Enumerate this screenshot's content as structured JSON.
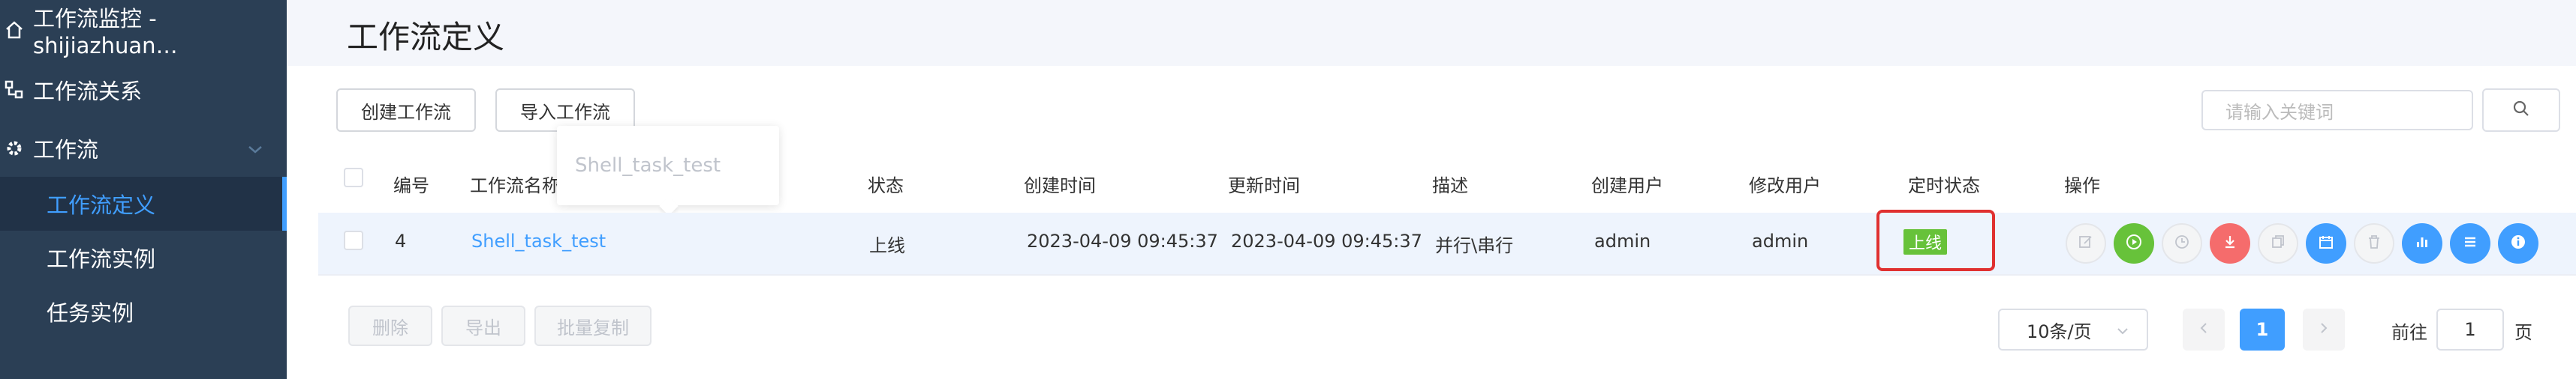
{
  "sidebar": {
    "items": [
      {
        "label": "工作流监控 - shijiazhuan…",
        "icon": "home-icon"
      },
      {
        "label": "工作流关系",
        "icon": "relation-icon"
      },
      {
        "label": "工作流",
        "icon": "gear-icon"
      }
    ],
    "sub_items": [
      {
        "label": "工作流定义",
        "active": true
      },
      {
        "label": "工作流实例",
        "active": false
      },
      {
        "label": "任务实例",
        "active": false
      }
    ]
  },
  "header": {
    "title": "工作流定义"
  },
  "toolbar": {
    "create_label": "创建工作流",
    "import_label": "导入工作流",
    "search_placeholder": "请输入关键词"
  },
  "tooltip": {
    "text": "Shell_task_test"
  },
  "table": {
    "headers": [
      "编号",
      "工作流名称",
      "状态",
      "创建时间",
      "更新时间",
      "描述",
      "创建用户",
      "修改用户",
      "定时状态",
      "操作"
    ],
    "rows": [
      {
        "id": "4",
        "name": "Shell_task_test",
        "status": "上线",
        "created": "2023-04-09 09:45:37",
        "updated": "2023-04-09 09:45:37",
        "description": "并行\\串行",
        "creator": "admin",
        "modifier": "admin",
        "schedule_status": "上线"
      }
    ]
  },
  "operations": [
    "edit-icon",
    "run-icon",
    "timer-icon",
    "download-icon",
    "copy-icon",
    "calendar-icon",
    "delete-icon",
    "chart-icon",
    "list-icon",
    "info-icon"
  ],
  "bottom_actions": {
    "delete_label": "删除",
    "export_label": "导出",
    "batch_copy_label": "批量复制"
  },
  "pagination": {
    "page_size": "10条/页",
    "current_page": "1",
    "goto_prefix": "前往",
    "goto_value": "1",
    "goto_suffix": "页"
  },
  "colors": {
    "sidebar_bg": "#2b3f55",
    "accent": "#409eff",
    "success": "#67c23a",
    "danger": "#f56c6c",
    "highlight": "#e03030"
  }
}
